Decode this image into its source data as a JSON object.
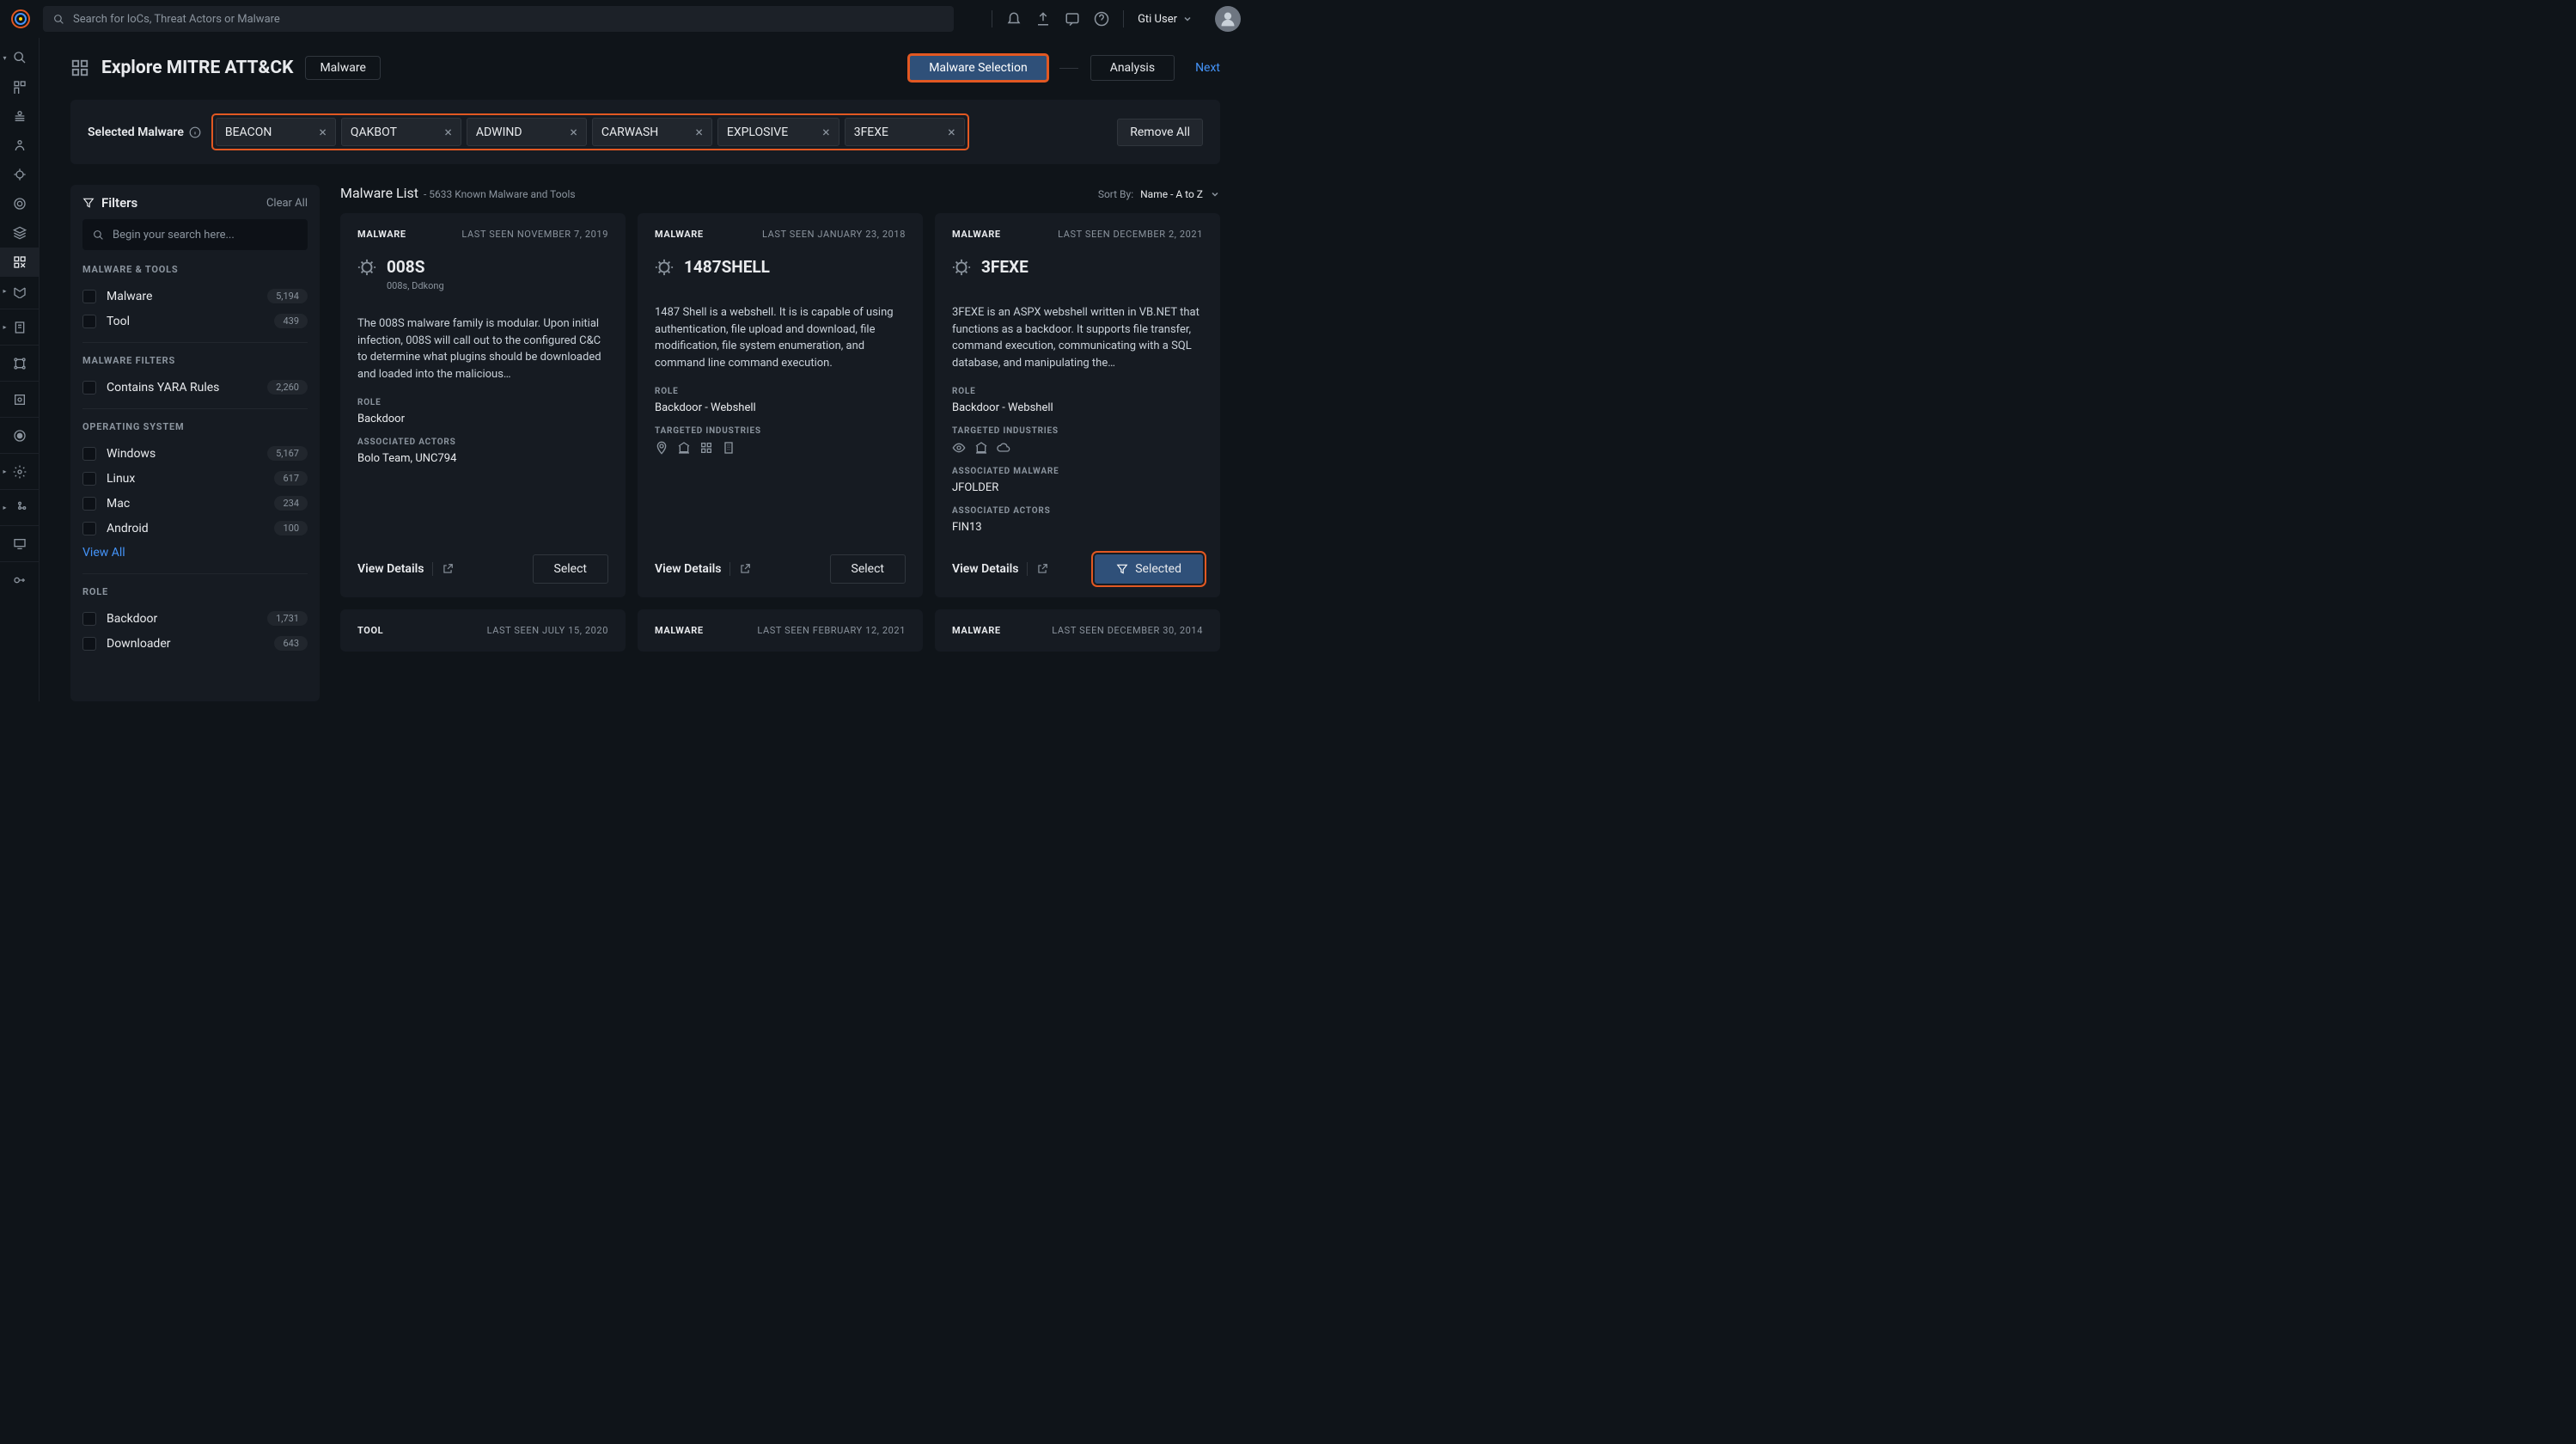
{
  "search_placeholder": "Search for IoCs, Threat Actors or Malware",
  "user": {
    "name": "Gti User"
  },
  "page": {
    "title": "Explore MITRE ATT&CK",
    "badge": "Malware",
    "step1": "Malware Selection",
    "step2": "Analysis",
    "next": "Next"
  },
  "selected_malware": {
    "label": "Selected Malware",
    "chips": [
      "BEACON",
      "QAKBOT",
      "ADWIND",
      "CARWASH",
      "EXPLOSIVE",
      "3FEXE"
    ],
    "remove_all": "Remove All"
  },
  "filters": {
    "title": "Filters",
    "clear_all": "Clear All",
    "search_placeholder": "Begin your search here...",
    "view_all": "View All",
    "sections": {
      "malware_tools": {
        "title": "MALWARE & TOOLS",
        "items": [
          {
            "label": "Malware",
            "count": "5,194"
          },
          {
            "label": "Tool",
            "count": "439"
          }
        ]
      },
      "malware_filters": {
        "title": "MALWARE FILTERS",
        "items": [
          {
            "label": "Contains YARA Rules",
            "count": "2,260"
          }
        ]
      },
      "operating_system": {
        "title": "OPERATING SYSTEM",
        "items": [
          {
            "label": "Windows",
            "count": "5,167"
          },
          {
            "label": "Linux",
            "count": "617"
          },
          {
            "label": "Mac",
            "count": "234"
          },
          {
            "label": "Android",
            "count": "100"
          }
        ]
      },
      "role": {
        "title": "ROLE",
        "items": [
          {
            "label": "Backdoor",
            "count": "1,731"
          },
          {
            "label": "Downloader",
            "count": "643"
          }
        ]
      }
    }
  },
  "list": {
    "title": "Malware List",
    "subtitle": "- 5633 Known Malware and Tools",
    "sort_by_label": "Sort By:",
    "sort_value": "Name - A to Z"
  },
  "labels": {
    "role": "ROLE",
    "associated_actors": "ASSOCIATED ACTORS",
    "targeted_industries": "TARGETED INDUSTRIES",
    "associated_malware": "ASSOCIATED MALWARE",
    "view_details": "View Details",
    "select": "Select",
    "selected": "Selected",
    "last_seen": "LAST SEEN"
  },
  "cards": [
    {
      "type": "MALWARE",
      "last_seen": "NOVEMBER 7, 2019",
      "name": "008S",
      "aliases": "008s, Ddkong",
      "desc": "The 008S malware family is modular. Upon initial infection, 008S will call out to the configured C&C to determine what plugins should be downloaded and loaded into the malicious…",
      "role": "Backdoor",
      "associated_actors": "Bolo Team,  UNC794"
    },
    {
      "type": "MALWARE",
      "last_seen": "JANUARY 23, 2018",
      "name": "1487SHELL",
      "desc": "1487 Shell is a webshell. It is is capable of using authentication, file upload and download, file modification, file system enumeration, and command line command execution.",
      "role": "Backdoor - Webshell"
    },
    {
      "type": "MALWARE",
      "last_seen": "DECEMBER 2, 2021",
      "name": "3FEXE",
      "desc": "3FEXE is an ASPX webshell written in VB.NET that functions as a backdoor. It supports file transfer, command execution, communicating with a SQL database, and manipulating the…",
      "role": "Backdoor - Webshell",
      "associated_malware": "JFOLDER",
      "associated_actors": "FIN13",
      "selected": true
    }
  ],
  "stubs": [
    {
      "type": "TOOL",
      "last_seen": "JULY 15, 2020"
    },
    {
      "type": "MALWARE",
      "last_seen": "FEBRUARY 12, 2021"
    },
    {
      "type": "MALWARE",
      "last_seen": "DECEMBER 30, 2014"
    }
  ]
}
